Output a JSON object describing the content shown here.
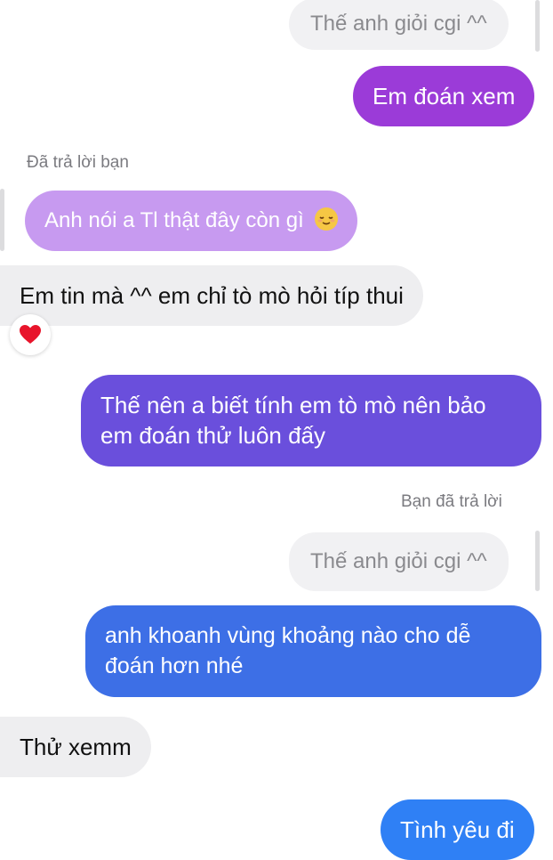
{
  "thread": {
    "top_quote": {
      "text": "Thế anh giỏi cgi ^^"
    },
    "msg_sent_1": {
      "text": "Em đoán xem",
      "color": "#9b3bd8"
    },
    "reply_meta_1": "Đã trả lời bạn",
    "reply_quote_1": {
      "text": "Anh nói a Tl thật đây còn gì",
      "emoji": "relieved-face",
      "color": "#c79af0"
    },
    "msg_received_1": {
      "text": "Em tin mà ^^ em chỉ tò mò hỏi típ thui",
      "reaction": "red-heart"
    },
    "msg_sent_2": {
      "line1": "Thế nên a biết tính em tò mò nên bảo",
      "line2": "em đoán thử luôn đấy",
      "color": "#6a4fdc"
    },
    "reply_meta_2": "Bạn đã trả lời",
    "reply_quote_2": {
      "text": "Thế anh giỏi cgi ^^"
    },
    "msg_sent_3": {
      "line1": "anh khoanh vùng khoảng nào cho dễ",
      "line2": "đoán hơn nhé",
      "color": "#3d6fe6"
    },
    "msg_received_2": {
      "text": "Thử xemm"
    },
    "msg_sent_4": {
      "text": "Tình yêu đi",
      "color": "#2f80f5"
    }
  }
}
